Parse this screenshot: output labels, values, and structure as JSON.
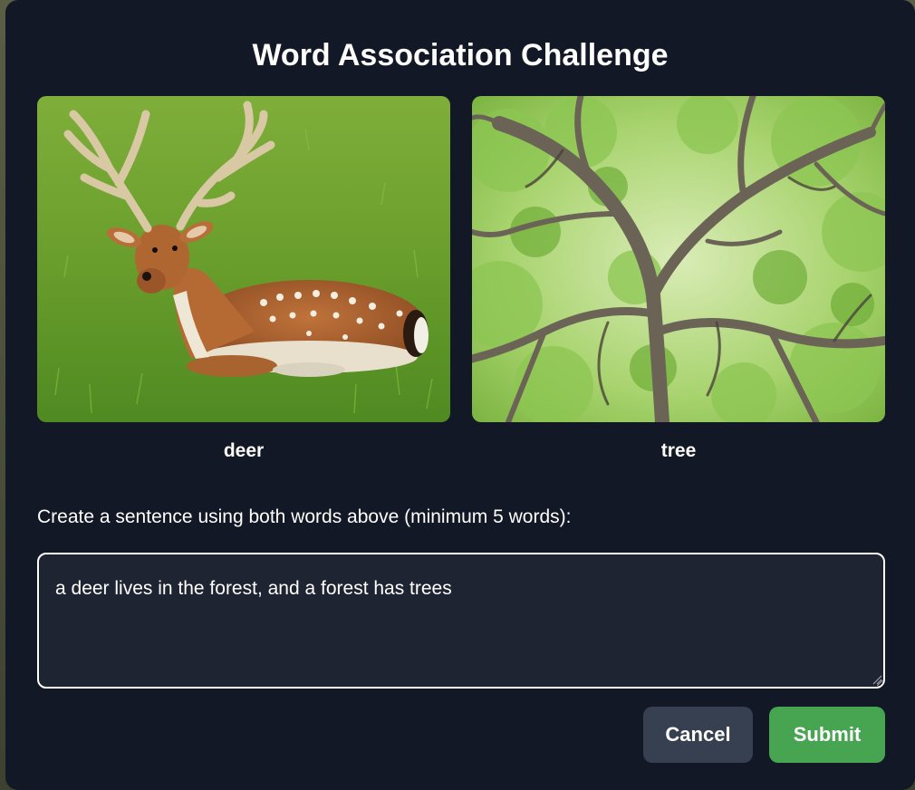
{
  "dialog": {
    "title": "Word Association Challenge"
  },
  "images": [
    {
      "word": "deer",
      "icon": "deer-photo"
    },
    {
      "word": "tree",
      "icon": "tree-photo"
    }
  ],
  "prompt": {
    "instruction": "Create a sentence using both words above (minimum 5 words):"
  },
  "sentence_input": {
    "value": "a deer lives in the forest, and a forest has trees"
  },
  "buttons": {
    "cancel_label": "Cancel",
    "submit_label": "Submit"
  },
  "colors": {
    "modal_bg": "#131826",
    "input_bg": "#1f2433",
    "cancel_bg": "#374051",
    "submit_bg": "#47a552"
  }
}
